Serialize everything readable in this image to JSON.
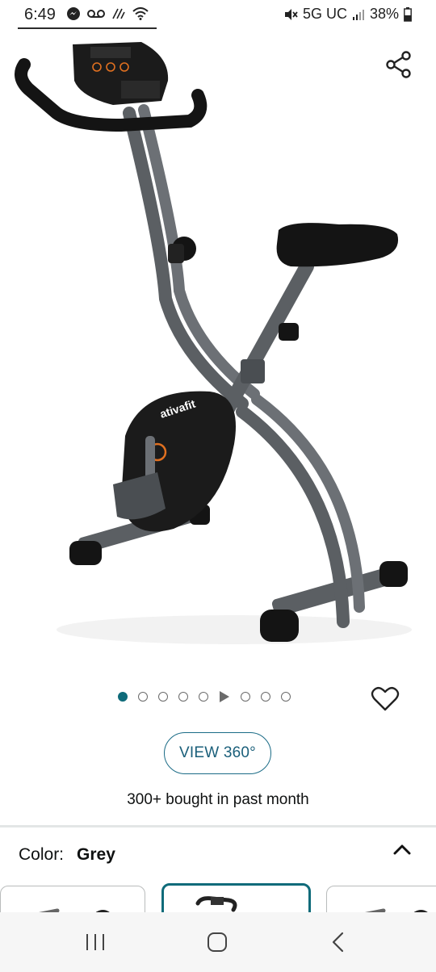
{
  "status_bar": {
    "time": "6:49",
    "network": "5G UC",
    "battery": "38%",
    "left_icons": [
      "messenger-icon",
      "voicemail-icon",
      "wifi-calling-icon",
      "wifi-icon"
    ],
    "right_icons": [
      "mute-icon",
      "signal-icon",
      "battery-icon"
    ]
  },
  "product": {
    "brand_on_image": "ativafit",
    "image_count": 9,
    "active_image_index": 0,
    "video_dot_index": 5
  },
  "actions": {
    "view360_label": "VIEW 360°",
    "bought_text": "300+ bought in past month"
  },
  "variant": {
    "label": "Color:",
    "value": "Grey",
    "selected_index": 1
  },
  "colors": {
    "accent": "#0f6b7a",
    "link": "#1a5f7a",
    "frame": "#5b5f63"
  }
}
